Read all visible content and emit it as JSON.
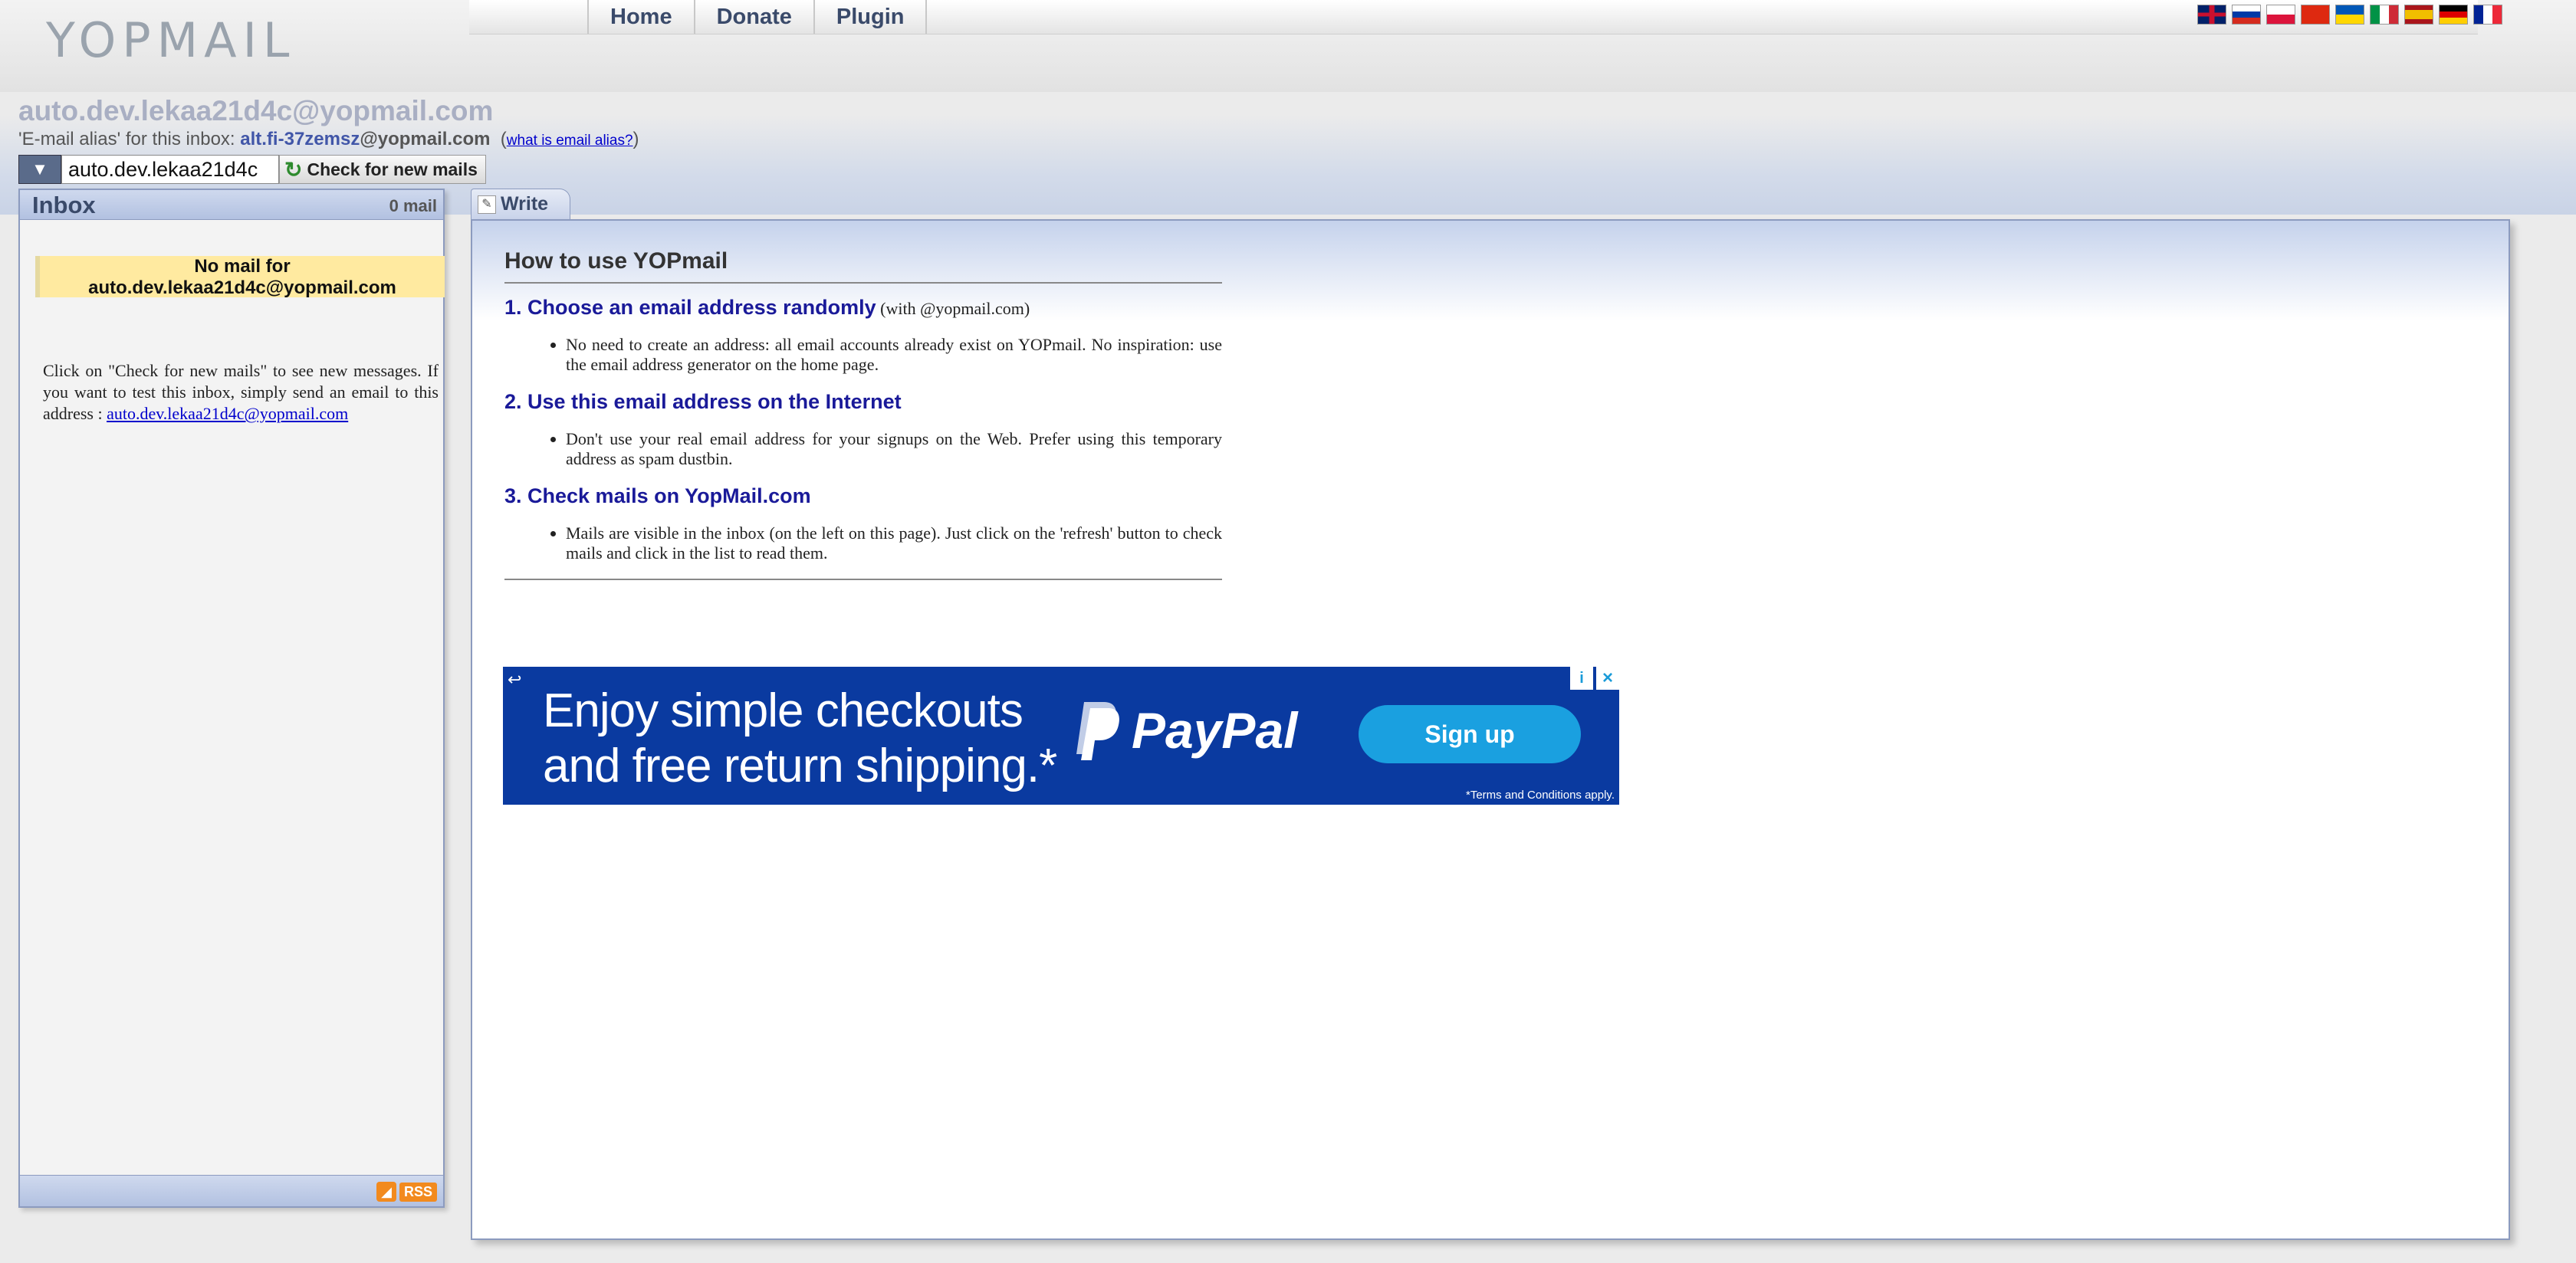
{
  "header": {
    "logo_text": "YOPMAIL",
    "nav": [
      "Home",
      "Donate",
      "Plugin"
    ],
    "flags": [
      "english-flag",
      "russian-flag",
      "polish-flag",
      "chinese-flag",
      "ukrainian-flag",
      "italian-flag",
      "spanish-flag",
      "german-flag",
      "french-flag"
    ]
  },
  "mailbox": {
    "address": "auto.dev.lekaa21d4c@yopmail.com",
    "alias_prefix": "'E-mail alias' for this inbox: ",
    "alias_user": "alt.fi-37zemsz",
    "alias_domain": "@yopmail.com",
    "alias_help_open": "(",
    "alias_help": "what is email alias?",
    "alias_help_close": ")",
    "login_value": "auto.dev.lekaa21d4c",
    "check_button": "Check for new mails"
  },
  "inbox": {
    "title": "Inbox",
    "count": "0 mail",
    "no_mail_line1": "No mail for",
    "no_mail_line2": "auto.dev.lekaa21d4c@yopmail.com",
    "help_text": "Click on \"Check for new mails\" to see new messages. If you want to test this inbox, simply send an email to this address :",
    "help_link": "auto.dev.lekaa21d4c@yopmail.com",
    "rss_label": "RSS"
  },
  "write_tab": {
    "label": "Write"
  },
  "howto": {
    "title": "How to use YOPmail",
    "steps": [
      {
        "heading": "1. Choose an email address randomly",
        "sub": " (with @yopmail.com)",
        "text": "No need to create an address: all email accounts already exist on YOPmail. No inspiration: use the email address generator on the home page."
      },
      {
        "heading": "2. Use this email address on the Internet",
        "sub": "",
        "text": "Don't use your real email address for your signups on the Web. Prefer using this temporary address as spam dustbin."
      },
      {
        "heading": "3. Check mails on YopMail.com",
        "sub": "",
        "text": "Mails are visible in the inbox (on the left on this page). Just click on the 'refresh' button to check mails and click in the list to read them."
      }
    ]
  },
  "ad": {
    "line1": "Enjoy simple checkouts",
    "line2": "and free return shipping.*",
    "brand": "PayPal",
    "cta": "Sign up",
    "terms": "*Terms and Conditions apply."
  },
  "colors": {
    "accent": "#1a1a99",
    "panel_border": "#8c9bbf",
    "ad_bg": "#0a3aa0",
    "ad_button": "#1aa0e0",
    "no_mail_bg": "#ffeaa0"
  }
}
